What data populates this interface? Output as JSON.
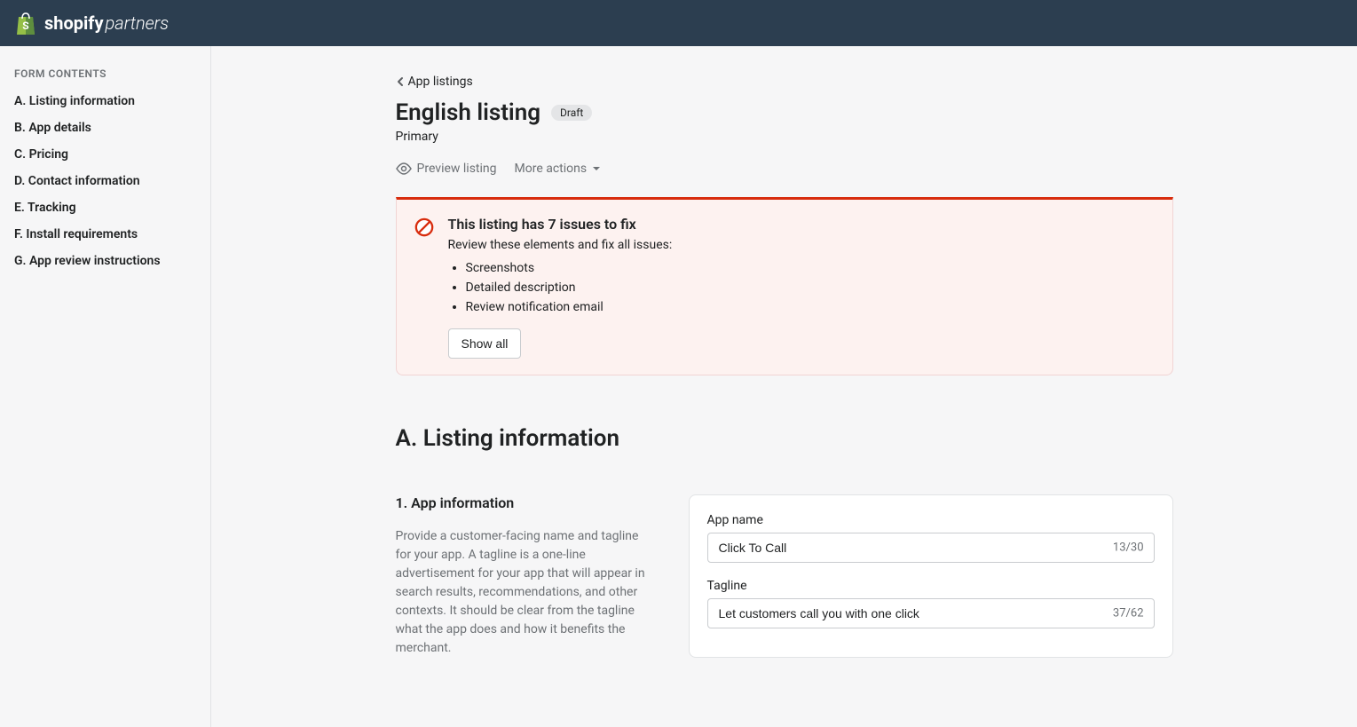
{
  "header": {
    "logo_bold": "shopify",
    "logo_italic": "partners"
  },
  "sidebar": {
    "heading": "FORM CONTENTS",
    "items": [
      {
        "label": "A. Listing information"
      },
      {
        "label": "B. App details"
      },
      {
        "label": "C. Pricing"
      },
      {
        "label": "D. Contact information"
      },
      {
        "label": "E. Tracking"
      },
      {
        "label": "F. Install requirements"
      },
      {
        "label": "G. App review instructions"
      }
    ]
  },
  "breadcrumb": {
    "label": "App listings"
  },
  "page": {
    "title": "English listing",
    "badge": "Draft",
    "subtitle": "Primary"
  },
  "actions": {
    "preview": "Preview listing",
    "more": "More actions"
  },
  "alert": {
    "title": "This listing has 7 issues to fix",
    "subtitle": "Review these elements and fix all issues:",
    "items": [
      "Screenshots",
      "Detailed description",
      "Review notification email"
    ],
    "show_all": "Show all"
  },
  "section": {
    "heading": "A. Listing information",
    "subsection_title": "1. App information",
    "subsection_desc": "Provide a customer-facing name and tagline for your app. A tagline is a one-line advertisement for your app that will appear in search results, recommendations, and other contexts. It should be clear from the tagline what the app does and how it benefits the merchant."
  },
  "form": {
    "app_name_label": "App name",
    "app_name_value": "Click To Call",
    "app_name_count": "13/30",
    "tagline_label": "Tagline",
    "tagline_value": "Let customers call you with one click",
    "tagline_count": "37/62"
  }
}
